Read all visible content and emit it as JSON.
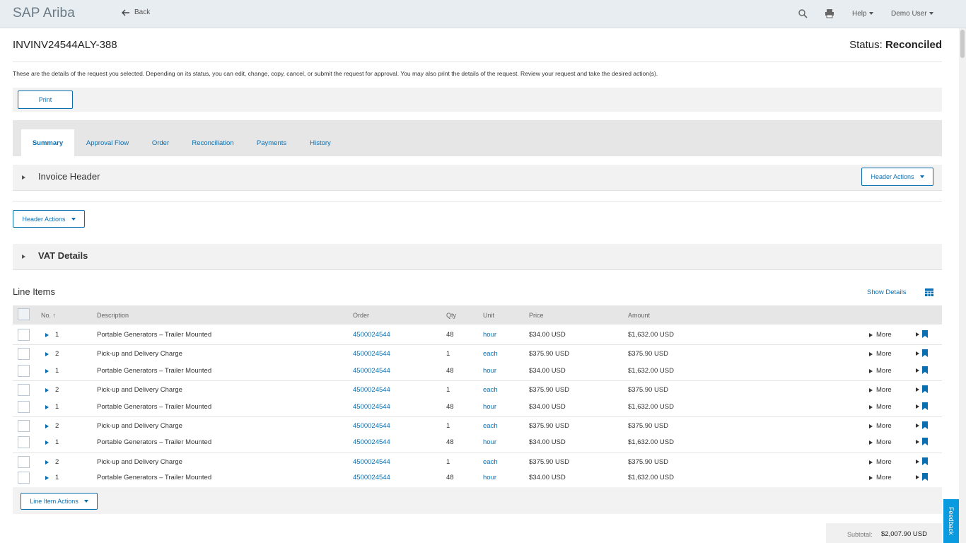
{
  "app": {
    "brand": "SAP Ariba",
    "back_label": "Back",
    "help_label": "Help",
    "user_label": "Demo User"
  },
  "document": {
    "id": "INVINV24544ALY-388",
    "status_label": "Status:",
    "status_value": "Reconciled",
    "description": "These are the details of the request you selected. Depending on its status, you can edit, change, copy, cancel, or submit the request for approval. You may also print the details of the request. Review your request and take the desired action(s).",
    "print_label": "Print"
  },
  "tabs": [
    {
      "label": "Summary",
      "active": true
    },
    {
      "label": "Approval Flow",
      "active": false
    },
    {
      "label": "Order",
      "active": false
    },
    {
      "label": "Reconciliation",
      "active": false
    },
    {
      "label": "Payments",
      "active": false
    },
    {
      "label": "History",
      "active": false
    }
  ],
  "invoice_header": {
    "title": "Invoice Header",
    "actions_label": "Header Actions"
  },
  "header_actions_label": "Header Actions",
  "vat": {
    "title": "VAT Details"
  },
  "line_items": {
    "title": "Line Items",
    "show_details": "Show Details",
    "columns": {
      "no": "No.",
      "description": "Description",
      "order": "Order",
      "qty": "Qty",
      "unit": "Unit",
      "price": "Price",
      "amount": "Amount"
    },
    "more_label": "More",
    "rows": [
      {
        "no": "1",
        "description": "Portable Generators – Trailer Mounted",
        "order": "4500024544",
        "qty": "48",
        "unit": "hour",
        "price": "$34.00 USD",
        "amount": "$1,632.00 USD"
      },
      {
        "no": "2",
        "description": "Pick-up and Delivery Charge",
        "order": "4500024544",
        "qty": "1",
        "unit": "each",
        "price": "$375.90 USD",
        "amount": "$375.90 USD"
      },
      {
        "no": "1",
        "description": "Portable Generators – Trailer Mounted",
        "order": "4500024544",
        "qty": "48",
        "unit": "hour",
        "price": "$34.00 USD",
        "amount": "$1,632.00 USD"
      },
      {
        "no": "2",
        "description": "Pick-up and Delivery Charge",
        "order": "4500024544",
        "qty": "1",
        "unit": "each",
        "price": "$375.90 USD",
        "amount": "$375.90 USD"
      },
      {
        "no": "1",
        "description": "Portable Generators – Trailer Mounted",
        "order": "4500024544",
        "qty": "48",
        "unit": "hour",
        "price": "$34.00 USD",
        "amount": "$1,632.00 USD"
      },
      {
        "no": "2",
        "description": "Pick-up and Delivery Charge",
        "order": "4500024544",
        "qty": "1",
        "unit": "each",
        "price": "$375.90 USD",
        "amount": "$375.90 USD"
      },
      {
        "no": "1",
        "description": "Portable Generators – Trailer Mounted",
        "order": "4500024544",
        "qty": "48",
        "unit": "hour",
        "price": "$34.00 USD",
        "amount": "$1,632.00 USD"
      },
      {
        "no": "2",
        "description": "Pick-up and Delivery Charge",
        "order": "4500024544",
        "qty": "1",
        "unit": "each",
        "price": "$375.90 USD",
        "amount": "$375.90 USD"
      },
      {
        "no": "1",
        "description": "Portable Generators – Trailer Mounted",
        "order": "4500024544",
        "qty": "48",
        "unit": "hour",
        "price": "$34.00 USD",
        "amount": "$1,632.00 USD"
      }
    ],
    "actions_label": "Line Item Actions",
    "subtotal_label": "Subtotal:",
    "subtotal_value": "$2,007.90 USD"
  },
  "feedback_label": "Feedback",
  "colors": {
    "accent": "#0a6fb0",
    "topbar": "#e8edf1",
    "feedback": "#0a9ae0"
  }
}
